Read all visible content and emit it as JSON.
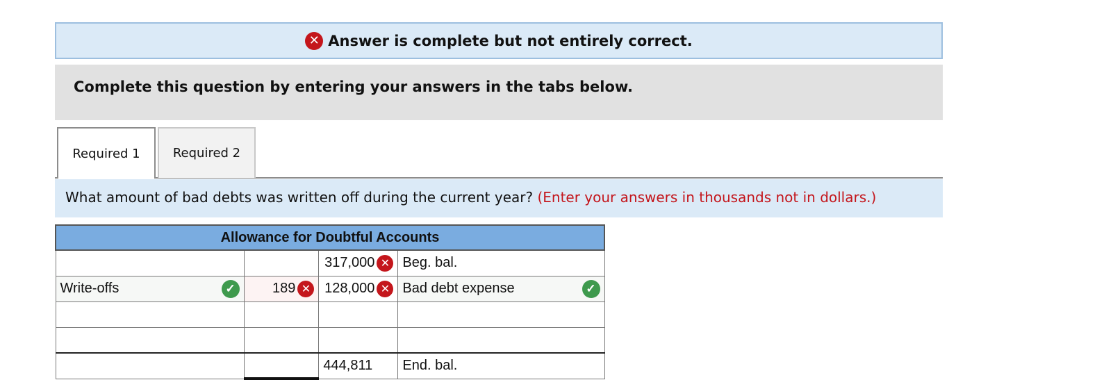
{
  "banner": {
    "message": "Answer is complete but not entirely correct."
  },
  "instructions": {
    "text": "Complete this question by entering your answers in the tabs below."
  },
  "tabs": [
    {
      "label": "Required 1",
      "active": true
    },
    {
      "label": "Required 2",
      "active": false
    }
  ],
  "question": {
    "text": "What amount of bad debts was written off during the current year?",
    "hint": "(Enter your answers in thousands not in dollars.)"
  },
  "t_account": {
    "title": "Allowance for Doubtful Accounts",
    "rows": [
      {
        "debit_label": "",
        "debit_amount": "",
        "credit_amount": "317,000",
        "credit_label": "Beg. bal."
      },
      {
        "debit_label": "Write-offs",
        "debit_amount": "189",
        "credit_amount": "128,000",
        "credit_label": "Bad debt expense"
      },
      {
        "debit_label": "",
        "debit_amount": "",
        "credit_amount": "",
        "credit_label": ""
      },
      {
        "debit_label": "",
        "debit_amount": "",
        "credit_amount": "",
        "credit_label": ""
      },
      {
        "debit_label": "",
        "debit_amount": "",
        "credit_amount": "444,811",
        "credit_label": "End. bal."
      }
    ]
  },
  "icons": {
    "incorrect": "x-mark-icon",
    "correct": "check-mark-icon"
  },
  "colors": {
    "incorrect": "#c4161c",
    "correct": "#3e9a4d",
    "banner_bg": "#dbeaf7",
    "header_bg": "#7aace0"
  }
}
